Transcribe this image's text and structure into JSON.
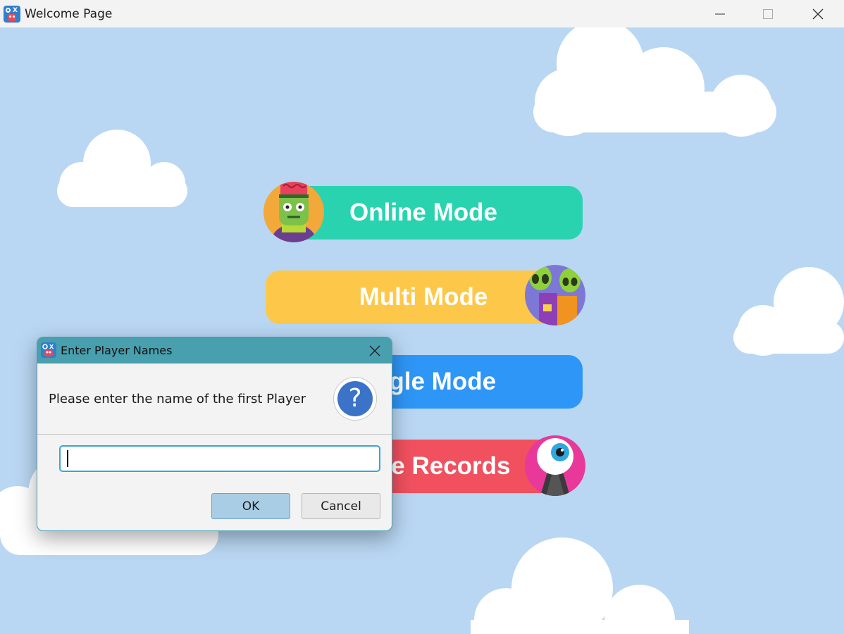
{
  "window": {
    "title": "Welcome Page",
    "icon": "app-logo-icon",
    "controls": [
      "minimize-icon",
      "maximize-icon",
      "close-icon"
    ]
  },
  "menu": {
    "online_label": "Online Mode",
    "multi_label": "Multi Mode",
    "single_label": "Single Mode",
    "records_label": "Game Records"
  },
  "dialog": {
    "title": "Enter Player Names",
    "message": "Please enter the name of the first Player",
    "input_value": "",
    "ok_label": "OK",
    "cancel_label": "Cancel",
    "icon": "question-icon"
  },
  "colors": {
    "background": "#b9d7f3",
    "online": "#2ad3b0",
    "multi": "#fdc84a",
    "single": "#2e96f7",
    "records": "#f1505f",
    "dialog_title": "#489fae"
  }
}
